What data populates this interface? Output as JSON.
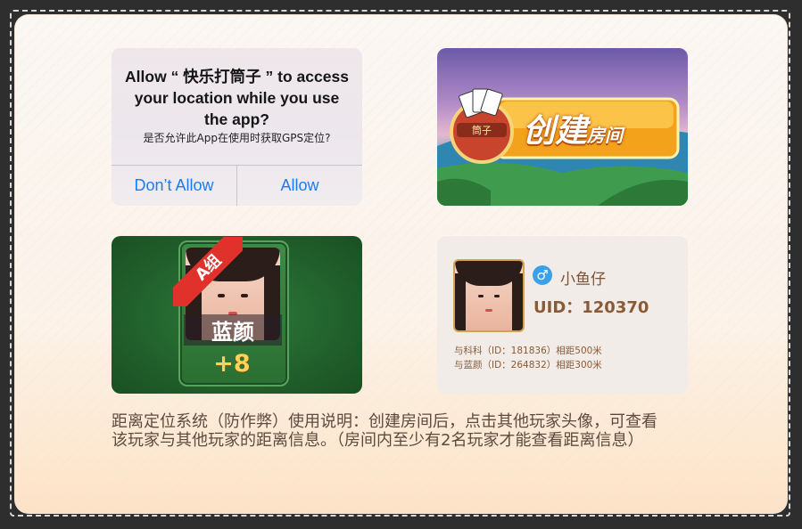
{
  "alert": {
    "title": "Allow “ 快乐打筒子 ” to access your location while you use the app?",
    "message": "是否允许此App在使用时获取GPS定位?",
    "deny_label": "Don’t Allow",
    "allow_label": "Allow"
  },
  "room_banner": {
    "badge_text": "筒子",
    "create_label": "创建",
    "room_label": "房间"
  },
  "player_badge": {
    "group_label": "A组",
    "name": "蓝颜",
    "score": "+8"
  },
  "user_info": {
    "gender_icon": "male-symbol-icon",
    "name": "小鱼仔",
    "uid": "UID：120370",
    "distances": [
      "与科科（ID：181836）相距500米",
      "与蓝颜（ID：264832）相距300米"
    ]
  },
  "footer": {
    "line1": "距离定位系统（防作弊）使用说明：创建房间后，点击其他玩家头像，可查看",
    "line2": "该玩家与其他玩家的距离信息。（房间内至少有2名玩家才能查看距离信息）"
  },
  "colors": {
    "ios_blue": "#1a7cf0",
    "table_green": "#1f5c2a",
    "gold": "#ffd35a",
    "brown_text": "#8a5a36"
  }
}
